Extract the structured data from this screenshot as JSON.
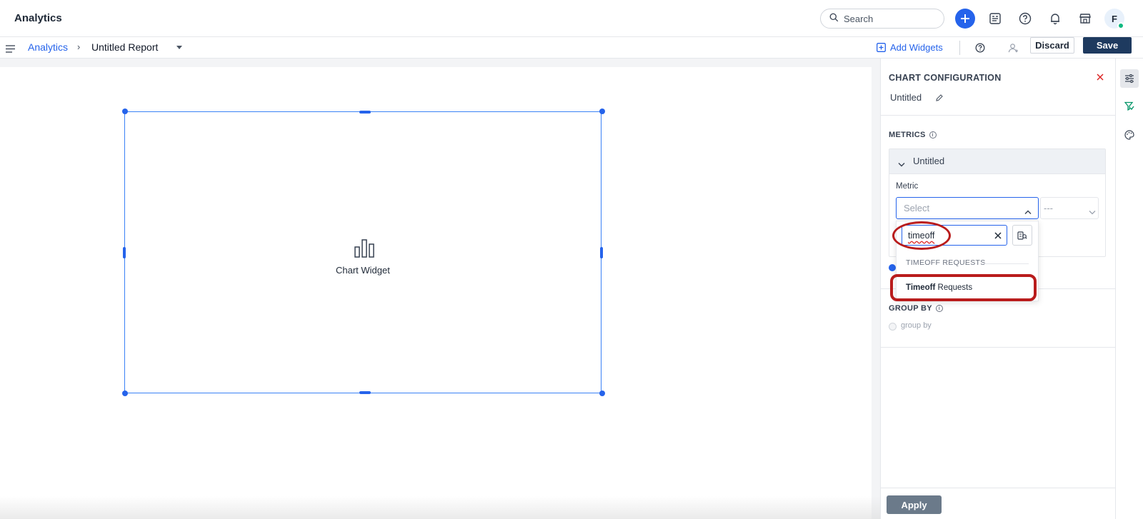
{
  "app": {
    "title": "Analytics"
  },
  "topbar": {
    "search_placeholder": "Search",
    "avatar_initial": "F",
    "icons": [
      "search-icon",
      "plus-icon",
      "report-icon",
      "help-icon",
      "bell-icon",
      "store-icon"
    ]
  },
  "breadcrumb": {
    "root": "Analytics",
    "separator": "›",
    "current": "Untitled Report"
  },
  "toolbar": {
    "add_widgets_label": "Add Widgets",
    "discard_label": "Discard",
    "save_label": "Save"
  },
  "canvas": {
    "widget_label": "Chart Widget"
  },
  "panel": {
    "title": "CHART CONFIGURATION",
    "chart_name": "Untitled",
    "metrics_label": "METRICS",
    "metric_item_label": "Untitled",
    "metric_field_label": "Metric",
    "select_placeholder": "Select",
    "aggregation_value": "---",
    "group_by_label": "GROUP BY",
    "group_by_placeholder": "group by",
    "apply_label": "Apply"
  },
  "dropdown": {
    "search_value": "timeoff",
    "group_header": "TIMEOFF REQUESTS",
    "option_match": "Timeoff",
    "option_rest": " Requests"
  },
  "colors": {
    "accent": "#2563eb",
    "save_button": "#1e3a5f",
    "annotation": "#b91c1c",
    "status_online": "#10b981"
  }
}
